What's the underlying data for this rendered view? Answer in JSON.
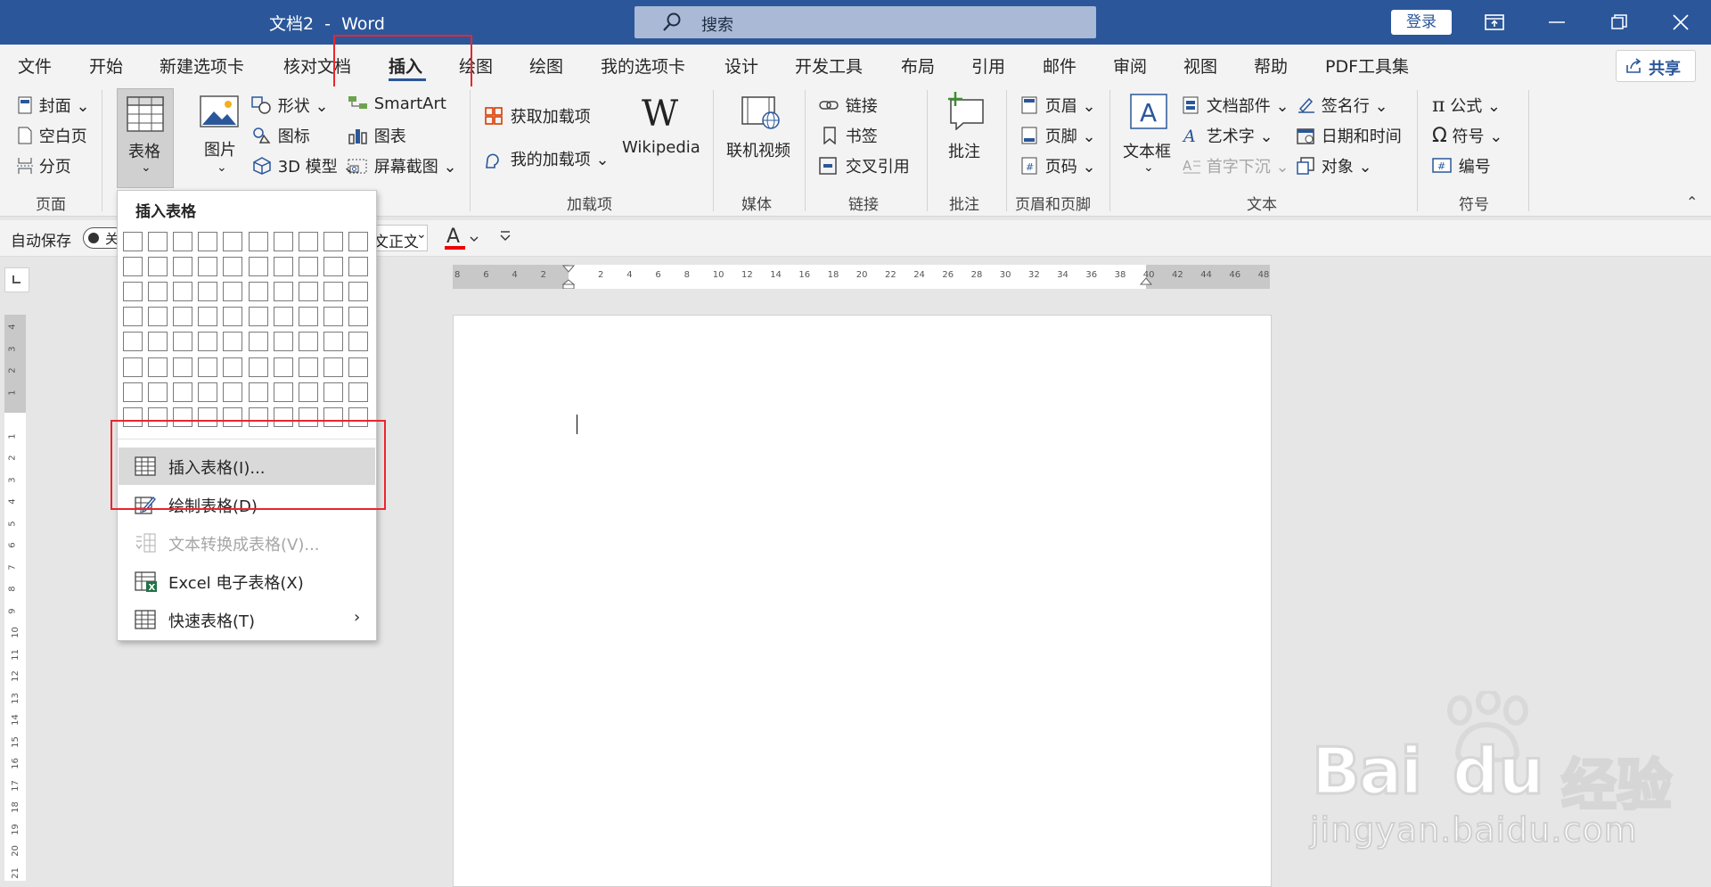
{
  "titlebar": {
    "doc_title": "文档2  -  Word",
    "search_placeholder": "搜索",
    "login_label": "登录"
  },
  "tabs": [
    "文件",
    "开始",
    "新建选项卡",
    "核对文档",
    "插入",
    "绘图",
    "绘图",
    "我的选项卡",
    "设计",
    "开发工具",
    "布局",
    "引用",
    "邮件",
    "审阅",
    "视图",
    "帮助",
    "PDF工具集"
  ],
  "active_tab": "插入",
  "share_label": "共享",
  "ribbon": {
    "page": {
      "cover": "封面",
      "blank": "空白页",
      "break": "分页",
      "group": "页面"
    },
    "table": {
      "label": "表格"
    },
    "illustrations": {
      "picture": "图片",
      "shapes": "形状",
      "icons": "图标",
      "model3d": "3D 模型",
      "smartart": "SmartArt",
      "chart": "图表",
      "screenshot": "屏幕截图"
    },
    "addins": {
      "get": "获取加载项",
      "mine": "我的加载项",
      "wikipedia": "Wikipedia",
      "group": "加载项"
    },
    "media": {
      "video": "联机视频",
      "group": "媒体"
    },
    "links": {
      "link": "链接",
      "bookmark": "书签",
      "crossref": "交叉引用",
      "group": "链接"
    },
    "comments": {
      "comment": "批注",
      "group": "批注"
    },
    "headerfooter": {
      "header": "页眉",
      "footer": "页脚",
      "pagenum": "页码",
      "group": "页眉和页脚"
    },
    "text": {
      "textbox": "文本框",
      "quickparts": "文档部件",
      "wordart": "艺术字",
      "dropcap": "首字下沉",
      "signature": "签名行",
      "datetime": "日期和时间",
      "object": "对象",
      "group": "文本"
    },
    "symbols": {
      "equation": "公式",
      "symbol": "符号",
      "number": "编号",
      "group": "符号"
    }
  },
  "qat": {
    "autosave": "自动保存",
    "toggle_text": "关",
    "font_partial": "文正文"
  },
  "dropdown": {
    "header": "插入表格",
    "items": [
      {
        "label": "插入表格(I)...",
        "state": "highlighted"
      },
      {
        "label": "绘制表格(D)",
        "state": "normal"
      },
      {
        "label": "文本转换成表格(V)...",
        "state": "disabled"
      },
      {
        "label": "Excel 电子表格(X)",
        "state": "normal"
      },
      {
        "label": "快速表格(T)",
        "state": "normal"
      }
    ]
  },
  "ruler": {
    "h_ticks": [
      "8",
      "6",
      "4",
      "2",
      "",
      "2",
      "4",
      "6",
      "8",
      "10",
      "12",
      "14",
      "16",
      "18",
      "20",
      "22",
      "24",
      "26",
      "28",
      "30",
      "32",
      "34",
      "36",
      "38",
      "40",
      "42",
      "44",
      "46",
      "48"
    ],
    "v_ticks": [
      "4",
      "3",
      "2",
      "1",
      "",
      "1",
      "2",
      "3",
      "4",
      "5",
      "6",
      "7",
      "8",
      "9",
      "10",
      "11",
      "12",
      "13",
      "14",
      "15",
      "16",
      "17",
      "18",
      "19",
      "20",
      "21"
    ]
  },
  "watermark": {
    "brand": "Bai",
    "brand2": "du",
    "cn": "经验",
    "url": "jingyan.baidu.com"
  },
  "colors": {
    "accent": "#2b579a",
    "highlight_box": "#e8262d"
  }
}
